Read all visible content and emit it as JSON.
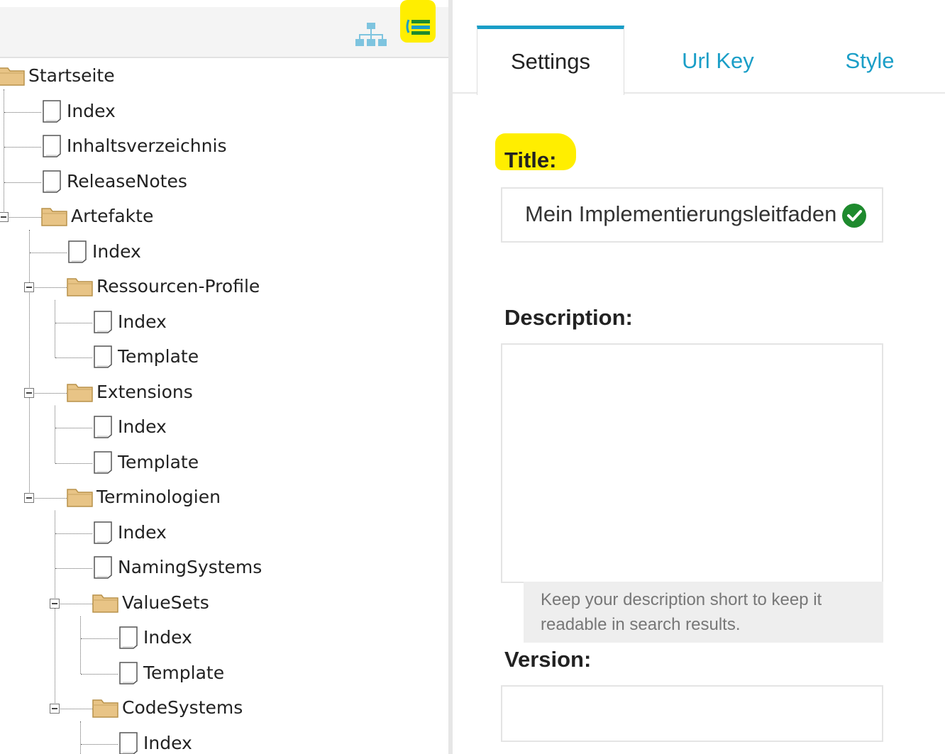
{
  "toolbar": {
    "sitemap_icon": "sitemap-icon",
    "list_icon": "list-icon",
    "highlight_color": "#ffee00"
  },
  "tree": {
    "nodes": [
      {
        "label": "Startseite",
        "type": "folder",
        "depth": 0
      },
      {
        "label": "Index",
        "type": "page",
        "depth": 1
      },
      {
        "label": "Inhaltsverzeichnis",
        "type": "page",
        "depth": 1
      },
      {
        "label": "ReleaseNotes",
        "type": "page",
        "depth": 1
      },
      {
        "label": "Artefakte",
        "type": "folder",
        "depth": 1
      },
      {
        "label": "Index",
        "type": "page",
        "depth": 2
      },
      {
        "label": "Ressourcen-Profile",
        "type": "folder",
        "depth": 2
      },
      {
        "label": "Index",
        "type": "page",
        "depth": 3
      },
      {
        "label": "Template",
        "type": "page",
        "depth": 3
      },
      {
        "label": "Extensions",
        "type": "folder",
        "depth": 2
      },
      {
        "label": "Index",
        "type": "page",
        "depth": 3
      },
      {
        "label": "Template",
        "type": "page",
        "depth": 3
      },
      {
        "label": "Terminologien",
        "type": "folder",
        "depth": 2
      },
      {
        "label": "Index",
        "type": "page",
        "depth": 3
      },
      {
        "label": "NamingSystems",
        "type": "page",
        "depth": 3
      },
      {
        "label": "ValueSets",
        "type": "folder",
        "depth": 3
      },
      {
        "label": "Index",
        "type": "page",
        "depth": 4
      },
      {
        "label": "Template",
        "type": "page",
        "depth": 4
      },
      {
        "label": "CodeSystems",
        "type": "folder",
        "depth": 3
      },
      {
        "label": "Index",
        "type": "page",
        "depth": 4
      }
    ]
  },
  "tabs": [
    {
      "label": "Settings",
      "active": true
    },
    {
      "label": "Url Key",
      "active": false
    },
    {
      "label": "Style",
      "active": false
    }
  ],
  "form": {
    "title_label": "Title:",
    "title_value": "Mein Implementierungsleitfaden",
    "title_status_icon": "check-circle-icon",
    "description_label": "Description:",
    "description_value": "",
    "description_help": "Keep your description short to keep it readable in search results.",
    "version_label": "Version:",
    "version_value": ""
  },
  "colors": {
    "accent": "#1a9ec7",
    "success": "#1e8a2e",
    "folder": "#e8c486"
  }
}
